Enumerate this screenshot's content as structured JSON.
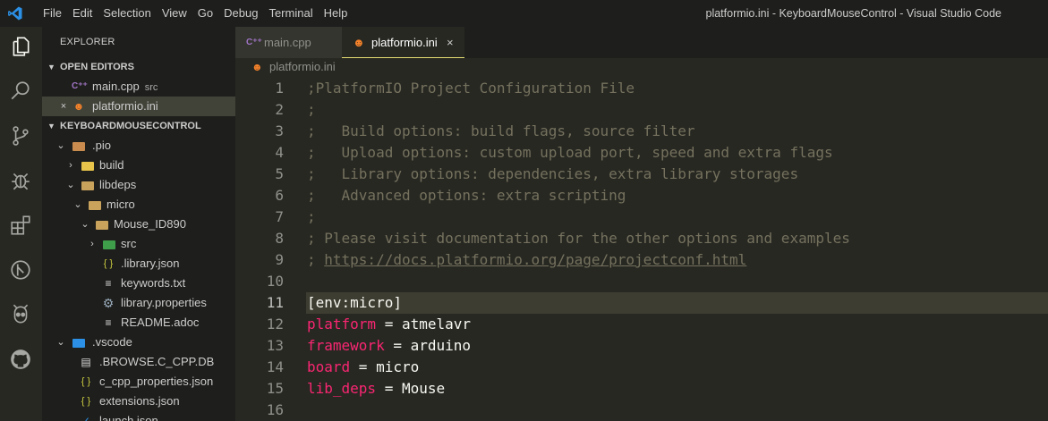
{
  "titlebar": {
    "menu": [
      "File",
      "Edit",
      "Selection",
      "View",
      "Go",
      "Debug",
      "Terminal",
      "Help"
    ],
    "window_title": "platformio.ini - KeyboardMouseControl - Visual Studio Code"
  },
  "activity_bar": {
    "icons": [
      "explorer-icon",
      "search-icon",
      "source-control-icon",
      "debug-icon",
      "extensions-icon",
      "git-graph-icon",
      "platformio-icon",
      "github-icon"
    ]
  },
  "sidebar": {
    "title": "EXPLORER",
    "open_editors": {
      "header": "OPEN EDITORS",
      "items": [
        {
          "label": "main.cpp",
          "desc": "src",
          "icon": "c++-icon"
        },
        {
          "label": "platformio.ini",
          "desc": "",
          "icon": "platformio-file-icon",
          "close": "×"
        }
      ]
    },
    "workspace": {
      "header": "KEYBOARDMOUSECONTROL",
      "items": [
        {
          "label": ".pio",
          "twisty": "⌄"
        },
        {
          "label": "build",
          "twisty": "›"
        },
        {
          "label": "libdeps",
          "twisty": "⌄"
        },
        {
          "label": "micro",
          "twisty": "⌄"
        },
        {
          "label": "Mouse_ID890",
          "twisty": "⌄"
        },
        {
          "label": "src",
          "twisty": "›"
        },
        {
          "label": ".library.json",
          "icon_glyph": "{ }"
        },
        {
          "label": "keywords.txt",
          "icon_glyph": "≡"
        },
        {
          "label": "library.properties",
          "icon_glyph": "⚙"
        },
        {
          "label": "README.adoc",
          "icon_glyph": "≡"
        },
        {
          "label": ".vscode",
          "twisty": "⌄"
        },
        {
          "label": ".BROWSE.C_CPP.DB",
          "icon_glyph": "▤"
        },
        {
          "label": "c_cpp_properties.json",
          "icon_glyph": "{ }"
        },
        {
          "label": "extensions.json",
          "icon_glyph": "{ }"
        },
        {
          "label": "launch.json",
          "icon_glyph": "✓"
        }
      ]
    }
  },
  "tabs": [
    {
      "label": "main.cpp",
      "icon": "C⁺⁺",
      "active": false
    },
    {
      "label": "platformio.ini",
      "icon": "☻",
      "active": true,
      "close": "×"
    }
  ],
  "breadcrumb": "platformio.ini",
  "editor": {
    "current_line": 11,
    "lines": [
      {
        "n": "1",
        "parts": [
          {
            "t": ";PlatformIO Project Configuration File",
            "c": "comment"
          }
        ]
      },
      {
        "n": "2",
        "parts": [
          {
            "t": ";",
            "c": "comment"
          }
        ]
      },
      {
        "n": "3",
        "parts": [
          {
            "t": ";   Build options: build flags, source filter",
            "c": "comment"
          }
        ]
      },
      {
        "n": "4",
        "parts": [
          {
            "t": ";   Upload options: custom upload port, speed and extra flags",
            "c": "comment"
          }
        ]
      },
      {
        "n": "5",
        "parts": [
          {
            "t": ";   Library options: dependencies, extra library storages",
            "c": "comment"
          }
        ]
      },
      {
        "n": "6",
        "parts": [
          {
            "t": ";   Advanced options: extra scripting",
            "c": "comment"
          }
        ]
      },
      {
        "n": "7",
        "parts": [
          {
            "t": ";",
            "c": "comment"
          }
        ]
      },
      {
        "n": "8",
        "parts": [
          {
            "t": "; Please visit documentation for the other options and examples",
            "c": "comment"
          }
        ]
      },
      {
        "n": "9",
        "parts": [
          {
            "t": "; ",
            "c": "comment"
          },
          {
            "t": "https://docs.platformio.org/page/projectconf.html",
            "c": "comment link"
          }
        ]
      },
      {
        "n": "10",
        "parts": []
      },
      {
        "n": "11",
        "parts": [
          {
            "t": "[env:micro]",
            "c": "plain"
          }
        ]
      },
      {
        "n": "12",
        "parts": [
          {
            "t": "platform",
            "c": "key"
          },
          {
            "t": " = atmelavr",
            "c": "plain"
          }
        ]
      },
      {
        "n": "13",
        "parts": [
          {
            "t": "framework",
            "c": "key"
          },
          {
            "t": " = arduino",
            "c": "plain"
          }
        ]
      },
      {
        "n": "14",
        "parts": [
          {
            "t": "board",
            "c": "key"
          },
          {
            "t": " = micro",
            "c": "plain"
          }
        ]
      },
      {
        "n": "15",
        "parts": [
          {
            "t": "lib_deps",
            "c": "key"
          },
          {
            "t": " = Mouse",
            "c": "plain"
          }
        ]
      },
      {
        "n": "16",
        "parts": []
      }
    ]
  },
  "colors": {
    "background": "#272822",
    "sidebar": "#1e1f1c",
    "comment": "#75715e",
    "keyword": "#f92672",
    "accent_tab_border": "#e6db74",
    "platformio_orange": "#f5822a",
    "cpp_purple": "#a074c4",
    "vscode_blue": "#2b90e6",
    "json_yellow": "#cbcb41"
  }
}
